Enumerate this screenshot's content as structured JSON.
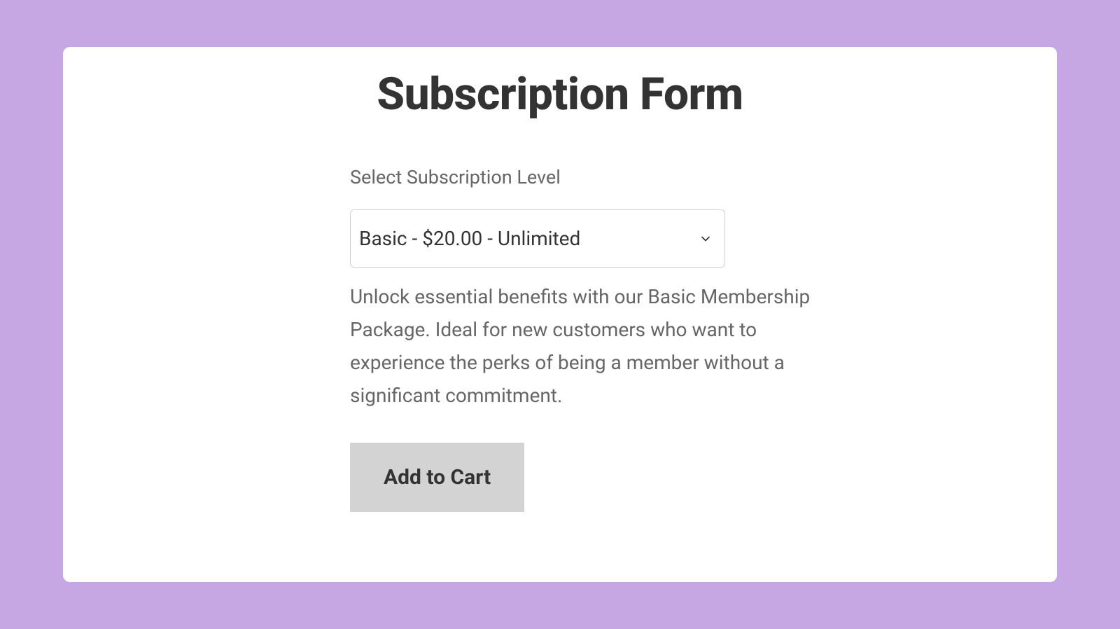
{
  "form": {
    "title": "Subscription Form",
    "field_label": "Select Subscription Level",
    "selected_option": "Basic - $20.00 - Unlimited",
    "description": "Unlock essential benefits with our Basic Membership Package. Ideal for new customers who want to experience the perks of being a member without a significant commitment.",
    "button_label": "Add to Cart"
  }
}
